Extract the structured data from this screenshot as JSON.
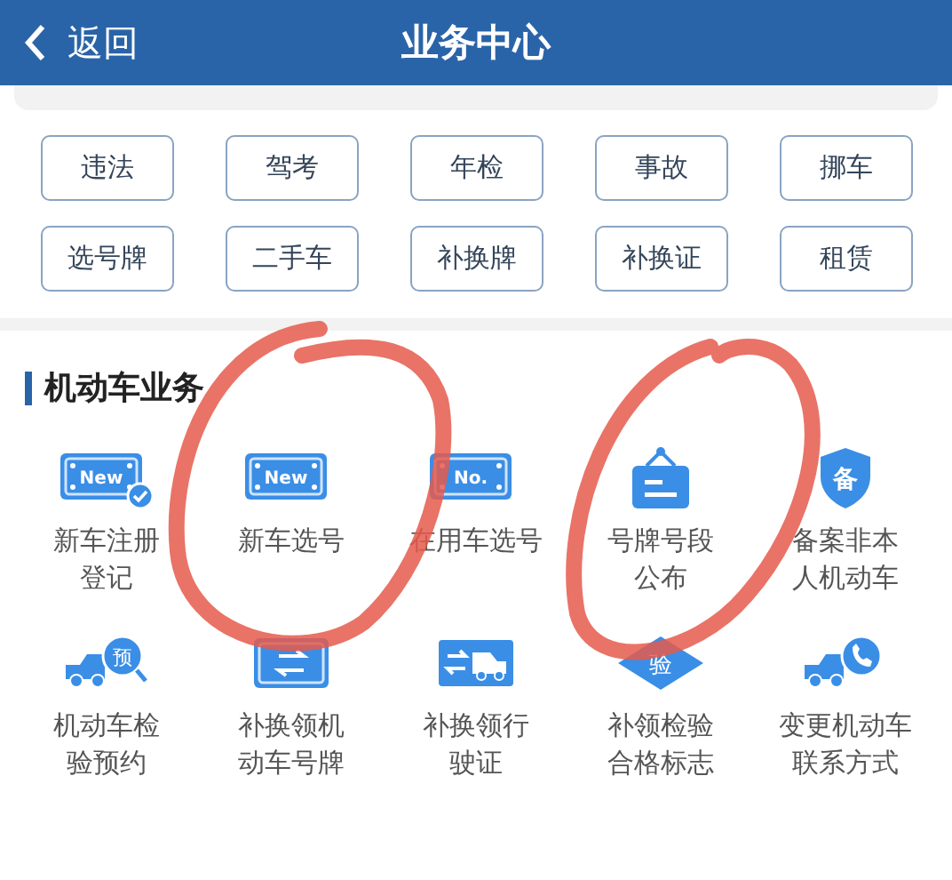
{
  "header": {
    "back_label": "返回",
    "title": "业务中心"
  },
  "quick_buttons": [
    {
      "label": "违法"
    },
    {
      "label": "驾考"
    },
    {
      "label": "年检"
    },
    {
      "label": "事故"
    },
    {
      "label": "挪车"
    },
    {
      "label": "选号牌"
    },
    {
      "label": "二手车"
    },
    {
      "label": "补换牌"
    },
    {
      "label": "补换证"
    },
    {
      "label": "租赁"
    }
  ],
  "section": {
    "title": "机动车业务"
  },
  "services": [
    {
      "kind": "plate-check",
      "badge": "New",
      "lines": [
        "新车注册",
        "登记"
      ]
    },
    {
      "kind": "plate",
      "badge": "New",
      "lines": [
        "新车选号"
      ]
    },
    {
      "kind": "plate",
      "badge": "No.",
      "lines": [
        "在用车选号"
      ]
    },
    {
      "kind": "sign",
      "lines": [
        "号牌号段",
        "公布"
      ]
    },
    {
      "kind": "shield",
      "badge": "备",
      "lines": [
        "备案非本",
        "人机动车"
      ]
    },
    {
      "kind": "truck-badge",
      "badge": "预",
      "lines": [
        "机动车检",
        "验预约"
      ]
    },
    {
      "kind": "plate-swap",
      "lines": [
        "补换领机",
        "动车号牌"
      ]
    },
    {
      "kind": "truck-swap",
      "lines": [
        "补换领行",
        "驶证"
      ]
    },
    {
      "kind": "diamond",
      "badge": "验",
      "lines": [
        "补领检验",
        "合格标志"
      ]
    },
    {
      "kind": "truck-phone",
      "lines": [
        "变更机动车",
        "联系方式"
      ]
    }
  ],
  "annotations": [
    {
      "kind": "circle"
    },
    {
      "kind": "circle"
    }
  ]
}
